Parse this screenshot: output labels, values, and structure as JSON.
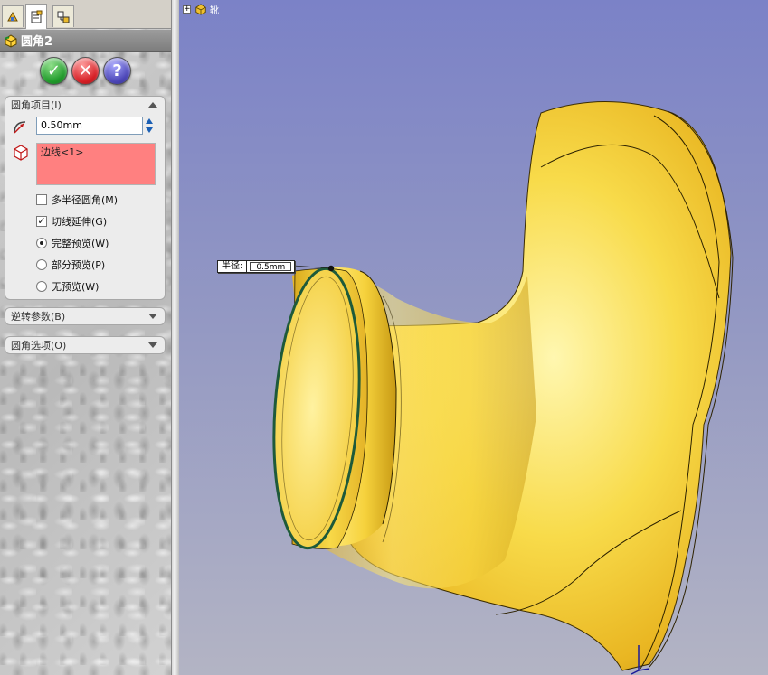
{
  "tabs": [
    {
      "name": "feature-manager",
      "icon": "feature-tree-icon"
    },
    {
      "name": "property-manager",
      "icon": "property-manager-icon"
    },
    {
      "name": "configuration-manager",
      "icon": "configuration-icon"
    }
  ],
  "panel": {
    "title": "圆角2",
    "title_icon": "fillet-feature-icon"
  },
  "actions": {
    "ok": "✓",
    "cancel": "✕",
    "help": "?"
  },
  "fillet_items": {
    "header": "圆角项目(I)",
    "radius_value": "0.50mm",
    "edges": [
      "边线<1>"
    ],
    "multi_radius_label": "多半径圆角(M)",
    "multi_radius_checked": false,
    "tangent_label": "切线延伸(G)",
    "tangent_checked": true,
    "preview_options": [
      {
        "label": "完整预览(W)",
        "selected": true
      },
      {
        "label": "部分预览(P)",
        "selected": false
      },
      {
        "label": "无预览(W)",
        "selected": false
      }
    ]
  },
  "setback_group": {
    "header": "逆转参数(B)"
  },
  "fillet_options_group": {
    "header": "圆角选项(O)"
  },
  "graphics": {
    "tree_root_label": "靴",
    "tree_expand": "+",
    "dimension_label": "半径:",
    "dimension_value": "0.5mm"
  },
  "colors": {
    "background_top": "#7b82c7",
    "model_yellow": "#f5d23a",
    "edges_list_bg": "#ff8080",
    "selected_edge": "#1e5a3a"
  }
}
